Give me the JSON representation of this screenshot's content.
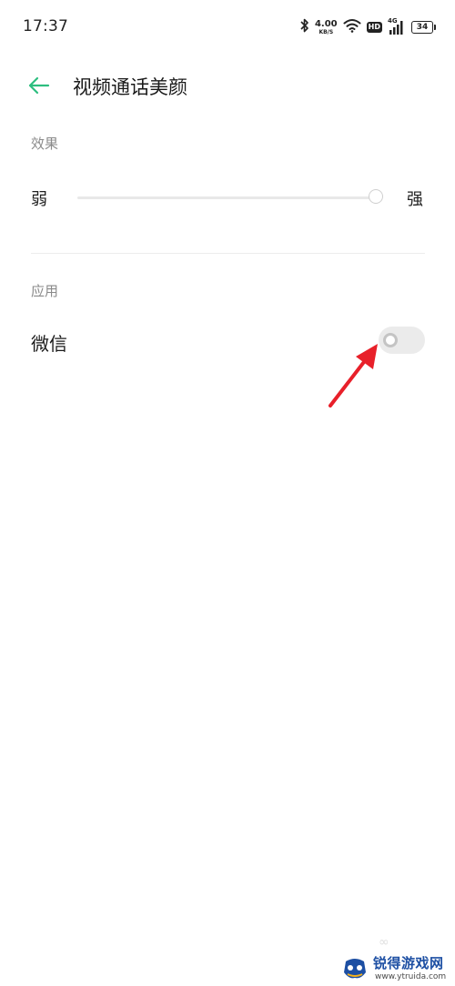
{
  "status_bar": {
    "time": "17:37",
    "net_speed_value": "4.00",
    "net_speed_unit": "KB/S",
    "hd_badge": "HD",
    "signal_tag": "4G",
    "battery": "34",
    "icons": [
      "bluetooth-icon",
      "wifi-icon",
      "hd-icon",
      "signal-icon",
      "battery-icon"
    ]
  },
  "header": {
    "title": "视频通话美颜",
    "back_icon": "back-arrow-icon"
  },
  "effect_section": {
    "label": "效果",
    "slider": {
      "min_label": "弱",
      "max_label": "强",
      "value": 1.0
    }
  },
  "apps_section": {
    "label": "应用",
    "items": [
      {
        "name": "微信",
        "enabled": false
      }
    ]
  },
  "watermark": {
    "title": "锐得游戏网",
    "url": "www.ytruida.com"
  },
  "colors": {
    "accent": "#2dbe7f",
    "annotation_arrow": "#e8202a",
    "background": "#ffffff",
    "toggle_off": "#ebebeb",
    "watermark_blue": "#1d4fa3"
  }
}
